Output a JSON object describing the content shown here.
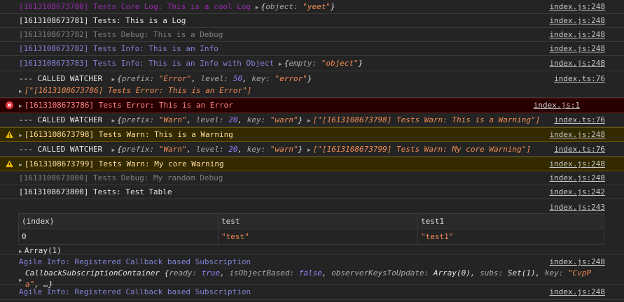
{
  "rows": [
    {
      "text": "[1613108673780] Tests Core Log: This is a cool Log",
      "obj": {
        "k1": "object",
        "v1": "\"yeet\""
      },
      "src": "index.js:248"
    },
    {
      "text": "[1613108673781] Tests: This is a Log",
      "src": "index.js:248"
    },
    {
      "text": "[1613108673782] Tests Debug: This is a Debug",
      "src": "index.js:248"
    },
    {
      "text": "[1613108673782] Tests Info: This is an Info",
      "src": "index.js:248"
    },
    {
      "text": "[1613108673783] Tests Info: This is an Info with Object",
      "obj": {
        "k1": "empty",
        "v1": "\"object\""
      },
      "src": "index.js:248"
    }
  ],
  "watchers": [
    {
      "label": "--- CALLED WATCHER",
      "prefix": "\"Error\"",
      "level": "50",
      "key": "\"error\"",
      "arr": "[\"[1613108673786] Tests Error: This is an Error\"]",
      "src": "index.ts:76"
    },
    {
      "label": "--- CALLED WATCHER",
      "prefix": "\"Warn\"",
      "level": "20",
      "key": "\"warn\"",
      "arr": "[\"[1613108673798] Tests Warn: This is a Warning\"]",
      "src": "index.ts:76"
    },
    {
      "label": "--- CALLED WATCHER",
      "prefix": "\"Warn\"",
      "level": "20",
      "key": "\"warn\"",
      "arr": "[\"[1613108673799] Tests Warn: My core Warning\"]",
      "src": "index.ts:76"
    }
  ],
  "keys": {
    "prefix": "prefix",
    "level": "level",
    "key": "key"
  },
  "error": {
    "text": "[1613108673786] Tests Error: This is an Error",
    "src": "index.js:1"
  },
  "warn1": {
    "text": "[1613108673798] Tests Warn: This is a Warning",
    "src": "index.js:248"
  },
  "warn2": {
    "text": "[1613108673799] Tests Warn: My core Warning",
    "src": "index.js:248"
  },
  "debug2": {
    "text": "[1613108673800] Tests Debug: My random Debug",
    "src": "index.js:248"
  },
  "tablelog": {
    "text": "[1613108673800] Tests: Test Table",
    "src": "index.js:242"
  },
  "table": {
    "src": "index.js:243",
    "headers": [
      "(index)",
      "test",
      "test1"
    ],
    "cells": [
      "0",
      "\"test\"",
      "\"test1\""
    ],
    "array": "Array(1)"
  },
  "agile1": {
    "text": "Agile Info: Registered Callback based Subscription",
    "src": "index.js:248",
    "cls": "CallbackSubscriptionContainer",
    "ready": "true",
    "isObjectBased": "false",
    "observerKeysToUpdate": "Array(0)",
    "subs": "Set(1)",
    "keyval": "\"CvpP",
    "tail": "a\"",
    "ellipsis": ", …}"
  },
  "agile2": {
    "text": "Agile Info: Registered Callback based Subscription",
    "src": "index.js:248"
  }
}
